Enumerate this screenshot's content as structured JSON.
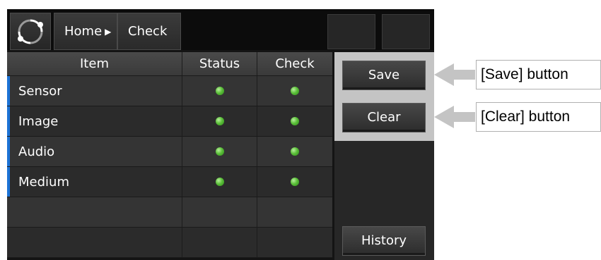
{
  "breadcrumb": {
    "home": "Home",
    "current": "Check"
  },
  "table": {
    "headers": [
      "Item",
      "Status",
      "Check"
    ],
    "rows": [
      {
        "item": "Sensor",
        "status": "ok",
        "check": "ok"
      },
      {
        "item": "Image",
        "status": "ok",
        "check": "ok"
      },
      {
        "item": "Audio",
        "status": "ok",
        "check": "ok"
      },
      {
        "item": "Medium",
        "status": "ok",
        "check": "ok"
      }
    ],
    "empty_rows": 2
  },
  "panel": {
    "save_label": "Save",
    "clear_label": "Clear",
    "history_label": "History"
  },
  "callouts": {
    "save": "[Save] button",
    "clear": "[Clear] button"
  },
  "colors": {
    "accent": "#1c73d6",
    "status_ok": "#5cc03a",
    "highlight": "#c4c4c4"
  },
  "icons": {
    "logo": "circular-arrows-logo-icon",
    "breadcrumb_separator": "triangle-right-icon",
    "status": "green-dot-icon"
  }
}
